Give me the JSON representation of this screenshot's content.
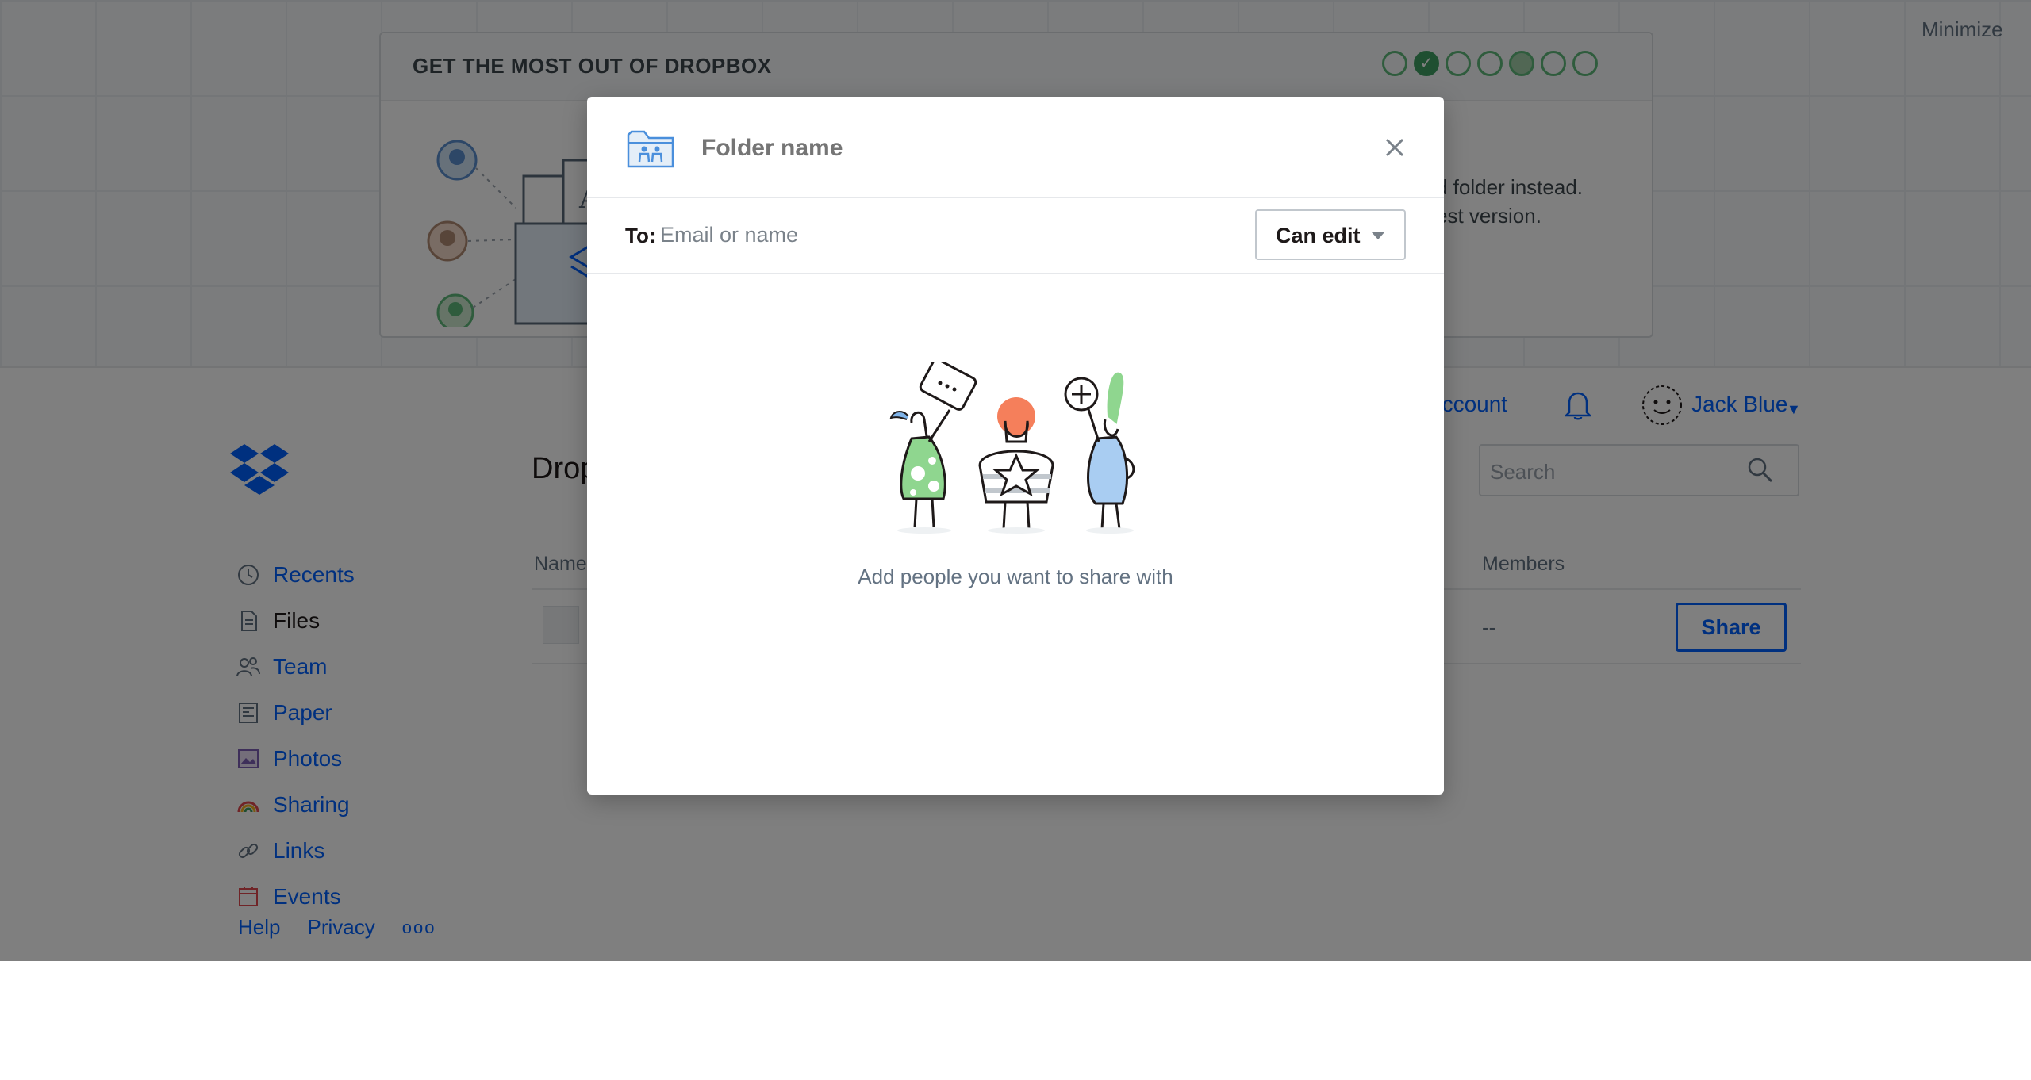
{
  "banner": {
    "minimize_label": "Minimize",
    "title": "GET THE MOST OUT OF DROPBOX",
    "steps": [
      "open",
      "done",
      "open",
      "open",
      "filled",
      "open",
      "open"
    ],
    "text_line1": "d folder instead.",
    "text_line2": "est version."
  },
  "header": {
    "account_label": "account",
    "user_name": "Jack Blue"
  },
  "sidebar": {
    "items": [
      {
        "label": "Recents",
        "icon": "clock-icon"
      },
      {
        "label": "Files",
        "icon": "file-icon"
      },
      {
        "label": "Team",
        "icon": "team-icon"
      },
      {
        "label": "Paper",
        "icon": "paper-icon"
      },
      {
        "label": "Photos",
        "icon": "photo-icon"
      },
      {
        "label": "Sharing",
        "icon": "rainbow-icon"
      },
      {
        "label": "Links",
        "icon": "link-icon"
      },
      {
        "label": "Events",
        "icon": "calendar-icon"
      }
    ],
    "active": "Files",
    "footer": {
      "help": "Help",
      "privacy": "Privacy",
      "more": "ooo"
    }
  },
  "main": {
    "title_partial": "Drop",
    "search_placeholder": "Search",
    "columns": {
      "name": "Name",
      "members": "Members"
    },
    "row": {
      "members": "--",
      "share_label": "Share"
    }
  },
  "modal": {
    "folder_name_placeholder": "Folder name",
    "to_label": "To:",
    "email_placeholder": "Email or name",
    "permission": "Can edit",
    "empty_text": "Add people you want to share with"
  },
  "colors": {
    "accent": "#0061fe",
    "progress_green": "#3f9f63",
    "overlay": "rgba(0,0,0,0.5)"
  }
}
